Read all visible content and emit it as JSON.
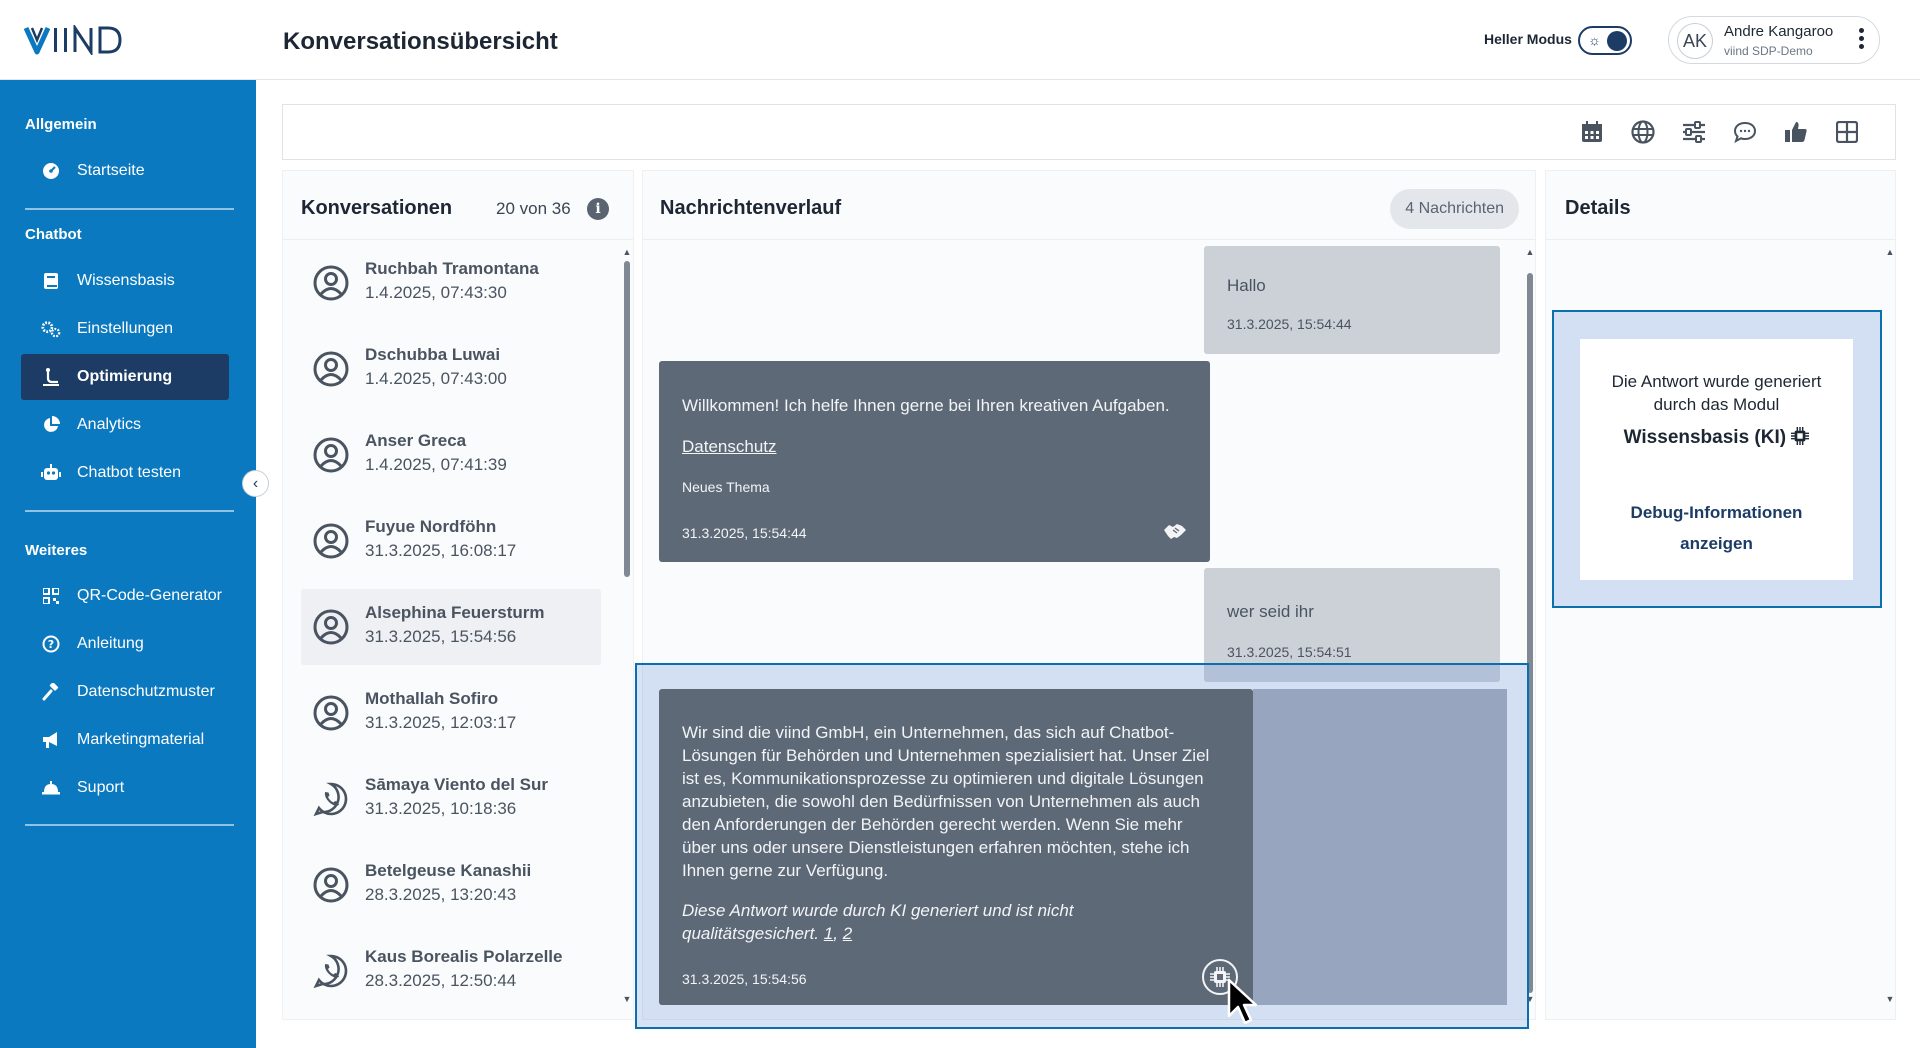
{
  "header": {
    "logo": "VIIND",
    "title": "Konversationsübersicht",
    "mode_label": "Heller Modus",
    "user": {
      "initials": "AK",
      "name": "Andre Kangaroo",
      "org": "viind SDP-Demo"
    }
  },
  "sidebar": {
    "sections": [
      {
        "label": "Allgemein"
      },
      {
        "label": "Chatbot"
      },
      {
        "label": "Weiteres"
      }
    ],
    "items": [
      {
        "label": "Startseite",
        "icon": "dashboard-icon"
      },
      {
        "label": "Wissensbasis",
        "icon": "book-icon"
      },
      {
        "label": "Einstellungen",
        "icon": "gears-icon"
      },
      {
        "label": "Optimierung",
        "icon": "optimize-icon",
        "active": true
      },
      {
        "label": "Analytics",
        "icon": "pie-chart-icon"
      },
      {
        "label": "Chatbot testen",
        "icon": "robot-icon"
      },
      {
        "label": "QR-Code-Generator",
        "icon": "qr-code-icon"
      },
      {
        "label": "Anleitung",
        "icon": "help-icon"
      },
      {
        "label": "Datenschutzmuster",
        "icon": "gavel-icon"
      },
      {
        "label": "Marketingmaterial",
        "icon": "megaphone-icon"
      },
      {
        "label": "Suport",
        "icon": "support-bell-icon"
      }
    ]
  },
  "filterbar": {
    "icons": [
      "calendar-icon",
      "globe-icon",
      "sliders-icon",
      "chat-bubble-icon",
      "thumbs-up-icon",
      "grid-icon"
    ]
  },
  "conversations": {
    "title": "Konversationen",
    "count": "20 von 36",
    "info_glyph": "i",
    "items": [
      {
        "name": "Ruchbah Tramontana",
        "date": "1.4.2025, 07:43:30",
        "channel": "user-circle-icon"
      },
      {
        "name": "Dschubba Luwai",
        "date": "1.4.2025, 07:43:00",
        "channel": "user-circle-icon"
      },
      {
        "name": "Anser Greca",
        "date": "1.4.2025, 07:41:39",
        "channel": "user-circle-icon"
      },
      {
        "name": "Fuyue Nordföhn",
        "date": "31.3.2025, 16:08:17",
        "channel": "user-circle-icon"
      },
      {
        "name": "Alsephina Feuersturm",
        "date": "31.3.2025, 15:54:56",
        "channel": "user-circle-icon",
        "selected": true
      },
      {
        "name": "Mothallah Sofiro",
        "date": "31.3.2025, 12:03:17",
        "channel": "user-circle-icon"
      },
      {
        "name": "Sāmaya Viento del Sur",
        "date": "31.3.2025, 10:18:36",
        "channel": "whatsapp-icon"
      },
      {
        "name": "Betelgeuse Kanashii",
        "date": "28.3.2025, 13:20:43",
        "channel": "user-circle-icon"
      },
      {
        "name": "Kaus Borealis Polarzelle",
        "date": "28.3.2025, 12:50:44",
        "channel": "whatsapp-icon"
      }
    ]
  },
  "messages": {
    "title": "Nachrichtenverlauf",
    "count_badge": "4 Nachrichten",
    "items": [
      {
        "role": "user",
        "text": "Hallo",
        "time": "31.3.2025, 15:54:44"
      },
      {
        "role": "bot",
        "text": "Willkommen! Ich helfe Ihnen gerne bei Ihren kreativen Aufgaben.",
        "link": "Datenschutz",
        "topic": "Neues Thema",
        "time": "31.3.2025, 15:54:44",
        "icon": "handshake-icon"
      },
      {
        "role": "user",
        "text": "wer seid ihr",
        "time": "31.3.2025, 15:54:51"
      },
      {
        "role": "bot",
        "text": "Wir sind die viind GmbH, ein Unternehmen, das sich auf Chatbot-Lösungen für Behörden und Unternehmen spezialisiert hat. Unser Ziel ist es, Kommunikationsprozesse zu optimieren und digitale Lösungen anzubieten, die sowohl den Bedürfnissen von Unternehmen als auch den Anforderungen der Behörden gerecht werden. Wenn Sie mehr über uns oder unsere Dienstleistungen erfahren möchten, stehe ich Ihnen gerne zur Verfügung.",
        "disclaimer": "Diese Antwort wurde durch KI generiert und ist nicht qualitätsgesichert.",
        "refs": [
          "1",
          "2"
        ],
        "ref_sep": ",",
        "time": "31.3.2025, 15:54:56",
        "icon": "ai-chip-icon"
      }
    ]
  },
  "details": {
    "title": "Details",
    "generated_text": "Die Antwort wurde generiert durch das Modul",
    "module": "Wissensbasis (KI)",
    "debug_link": "Debug-Informationen anzeigen"
  },
  "colors": {
    "brand_blue": "#0b79bf",
    "navy": "#1c3c66",
    "bot_bubble": "#5e6978",
    "user_bubble": "#ccd1d7"
  }
}
